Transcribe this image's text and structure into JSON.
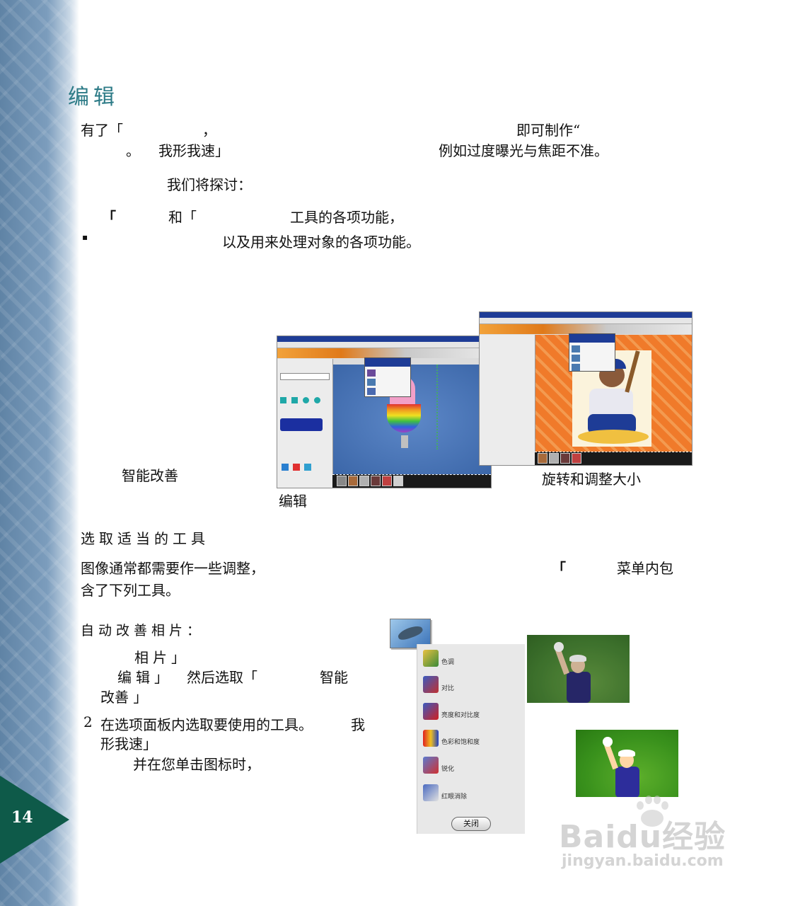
{
  "page": {
    "number": "14"
  },
  "heading": "编辑",
  "intro": {
    "line1_a": "有了「",
    "line1_b": "，",
    "line1_c": "即可制作“",
    "line2_a": "。",
    "line2_b": "我形我速」",
    "line2_c": "例如过度曝光与焦距不准。",
    "line3": "我们将探讨：",
    "bullet1_a": "「",
    "bullet1_b": "和「",
    "bullet1_c": "工具的各项功能，",
    "bullet2_mark": "▪",
    "bullet2": "以及用来处理对象的各项功能。"
  },
  "screenshots": {
    "left_caption": "智能改善",
    "mid_caption": "编辑",
    "right_caption": "旋转和调整大小"
  },
  "section2": {
    "title": "选取适当的工具",
    "para_a": "图像通常都需要作一些调整，",
    "para_b": "「",
    "para_c": "菜单内包",
    "para_d": "含了下列工具。"
  },
  "auto_fix": {
    "title": "自动改善相片：",
    "step1_a": "相片」",
    "step1_b": "编辑」",
    "step1_c": "然后选取「",
    "step1_d": "智能",
    "step1_e": "改善 」",
    "step2_num": "2",
    "step2_a": "在选项面板内选取要使用的工具。",
    "step2_b": "我",
    "step2_c": "形我速」",
    "step2_d": "并在您单击图标时，"
  },
  "panel": {
    "items": [
      "色调",
      "对比",
      "亮度和对比度",
      "色彩和饱和度",
      "锐化",
      "红眼消除"
    ],
    "close_button": "关闭"
  },
  "colors": {
    "sidebar": "#6f92b4",
    "page_tab": "#0e5a49",
    "heading": "#2b7a86"
  },
  "watermark": {
    "logo": "Baidu经验",
    "url": "jingyan.baidu.com"
  }
}
